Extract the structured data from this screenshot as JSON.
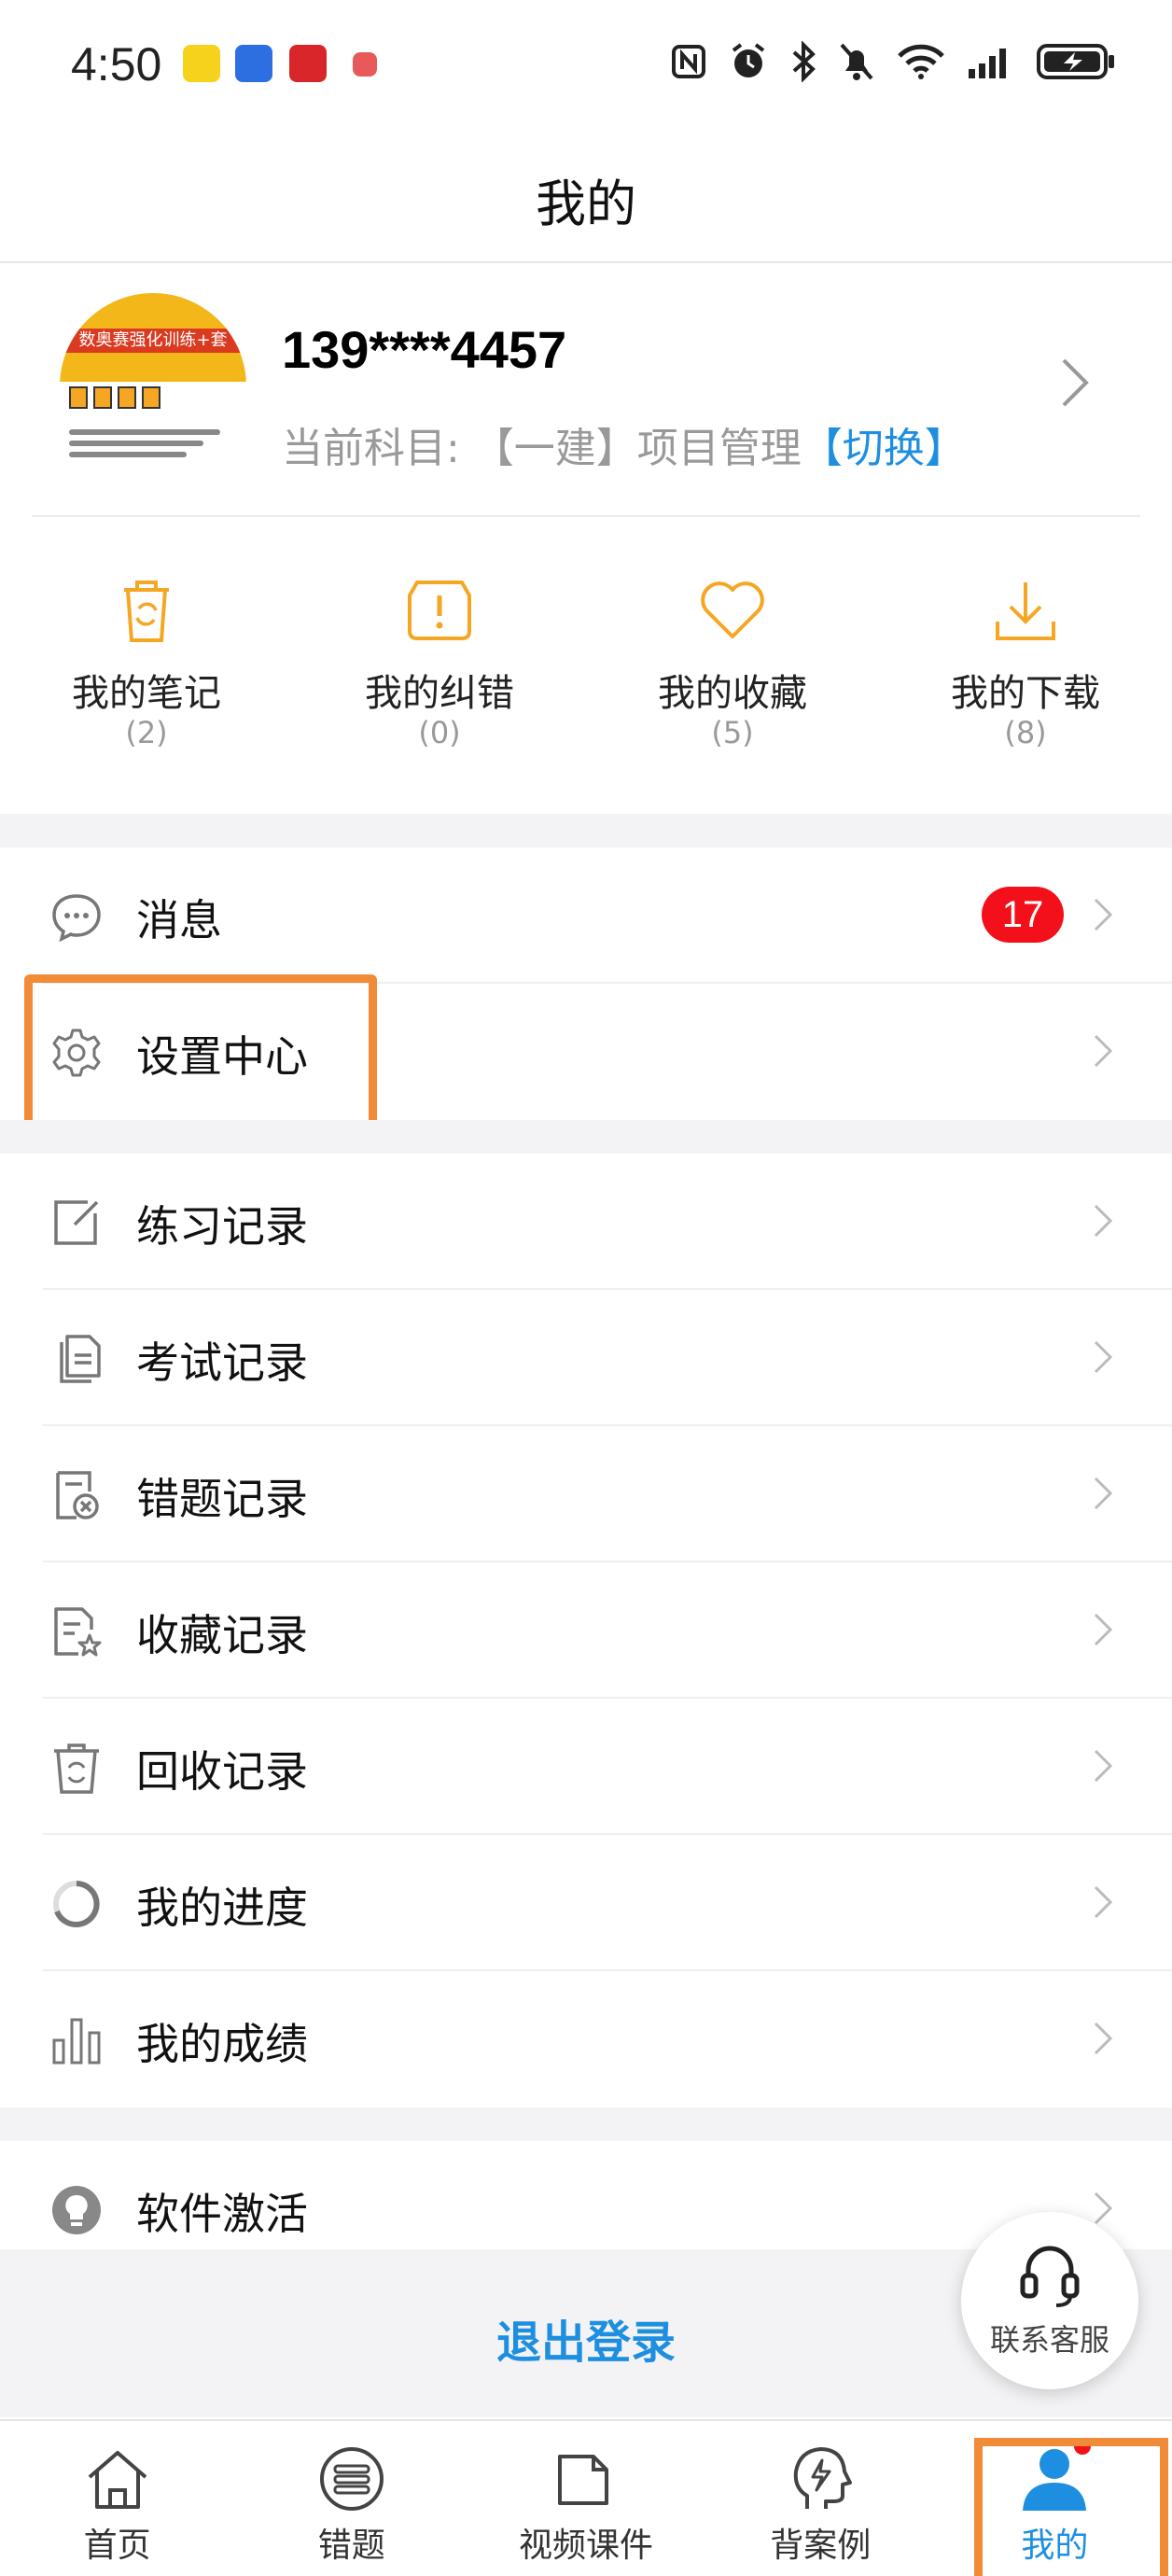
{
  "status_bar": {
    "time": "4:50",
    "icons": [
      "nfc-icon",
      "alarm-icon",
      "bluetooth-icon",
      "mute-icon",
      "wifi-icon",
      "signal-icon",
      "battery-charging-icon"
    ]
  },
  "header": {
    "title": "我的"
  },
  "profile": {
    "avatar_banner_text": "数奥赛强化训练+套",
    "phone": "139****4457",
    "subject_prefix": "当前科目: ",
    "subject_name": "【一建】项目管理",
    "switch_label": "【切换】"
  },
  "quick_actions": [
    {
      "label": "我的笔记",
      "count": "(2)",
      "icon": "notes-trash-icon"
    },
    {
      "label": "我的纠错",
      "count": "(0)",
      "icon": "alert-icon"
    },
    {
      "label": "我的收藏",
      "count": "(5)",
      "icon": "heart-icon"
    },
    {
      "label": "我的下载",
      "count": "(8)",
      "icon": "download-icon"
    }
  ],
  "menu_group_1": [
    {
      "label": "消息",
      "icon": "message-icon",
      "badge": "17"
    },
    {
      "label": "设置中心",
      "icon": "gear-icon"
    }
  ],
  "menu_group_2": [
    {
      "label": "练习记录",
      "icon": "edit-icon"
    },
    {
      "label": "考试记录",
      "icon": "document-icon"
    },
    {
      "label": "错题记录",
      "icon": "wrong-doc-icon"
    },
    {
      "label": "收藏记录",
      "icon": "star-doc-icon"
    },
    {
      "label": "回收记录",
      "icon": "recycle-icon"
    },
    {
      "label": "我的进度",
      "icon": "progress-icon"
    },
    {
      "label": "我的成绩",
      "icon": "bar-chart-icon"
    }
  ],
  "menu_group_3": [
    {
      "label": "软件激活",
      "icon": "bulb-icon"
    }
  ],
  "logout_label": "退出登录",
  "customer_service_label": "联系客服",
  "tabs": [
    {
      "label": "首页",
      "icon": "home-icon"
    },
    {
      "label": "错题",
      "icon": "wrong-list-icon"
    },
    {
      "label": "视频课件",
      "icon": "folder-icon"
    },
    {
      "label": "背案例",
      "icon": "head-icon"
    },
    {
      "label": "我的",
      "icon": "user-icon",
      "active": true
    }
  ],
  "colors": {
    "accent": "#1e8fe0",
    "highlight": "#f18b38",
    "badge": "#f3101a",
    "quick_icon": "#f5a623"
  }
}
